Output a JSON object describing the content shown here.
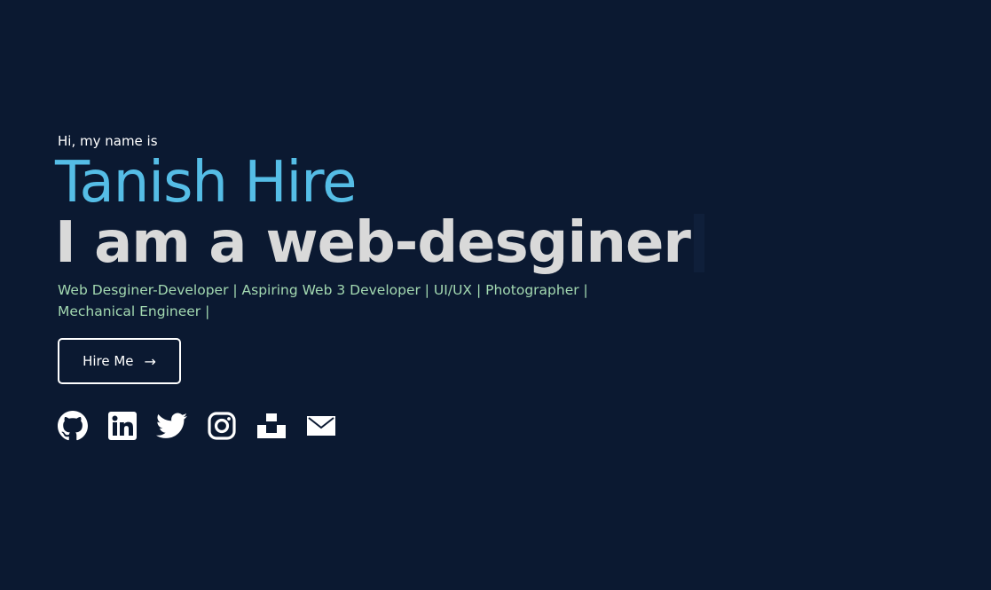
{
  "hero": {
    "greeting": "Hi, my name is",
    "name": "Tanish Hire",
    "role_prefix": "I am a",
    "role_typed": "web-desginer",
    "tagline": "Web Desginer-Developer | Aspiring Web 3 Developer | UI/UX | Photographer | Mechanical Engineer |"
  },
  "cta": {
    "label": "Hire Me",
    "arrow": "→"
  },
  "socials": [
    {
      "name": "github-icon"
    },
    {
      "name": "linkedin-icon"
    },
    {
      "name": "twitter-icon"
    },
    {
      "name": "instagram-icon"
    },
    {
      "name": "unsplash-icon"
    },
    {
      "name": "mail-icon"
    }
  ],
  "colors": {
    "background": "#0b1931",
    "accent": "#55bde6",
    "role": "#d9d9d9",
    "tagline": "#a3d9b1",
    "text": "#ffffff"
  }
}
